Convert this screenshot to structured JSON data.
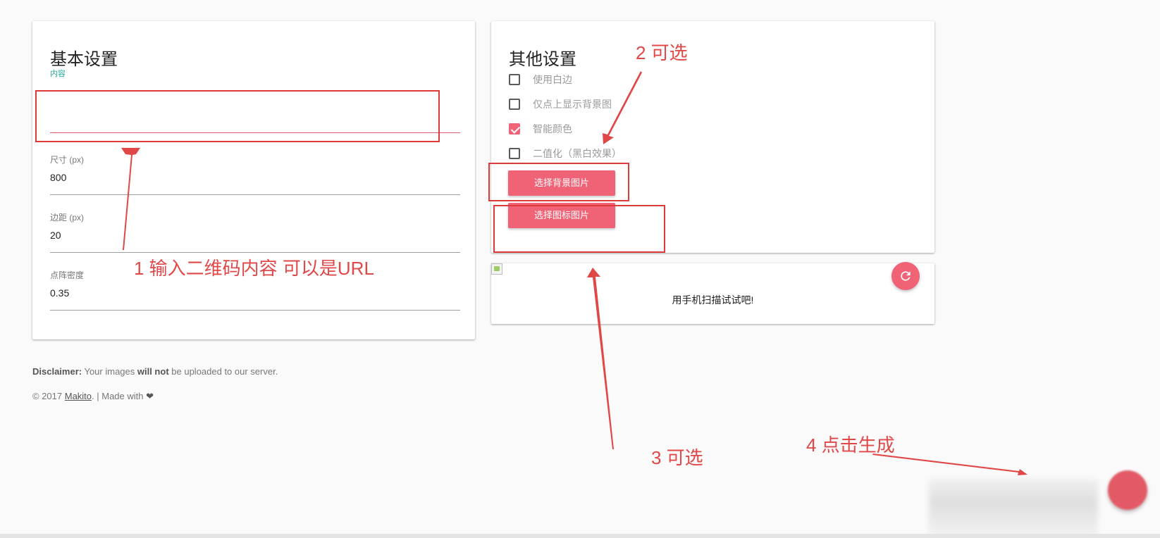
{
  "basic": {
    "title": "基本设置",
    "content_label": "内容",
    "content_value": "",
    "size_label": "尺寸 (px)",
    "size_value": "800",
    "margin_label": "边距 (px)",
    "margin_value": "20",
    "density_label": "点阵密度",
    "density_value": "0.35"
  },
  "other": {
    "title": "其他设置",
    "options": [
      {
        "label": "使用白边",
        "checked": false
      },
      {
        "label": "仅点上显示背景图",
        "checked": false
      },
      {
        "label": "智能颜色",
        "checked": true
      },
      {
        "label": "二值化（黑白效果）",
        "checked": false
      }
    ],
    "bg_button": "选择背景图片",
    "icon_button": "选择图标图片"
  },
  "preview": {
    "scan_text": "用手机扫描试试吧!"
  },
  "footer": {
    "disclaimer_bold": "Disclaimer:",
    "disclaimer_text1": " Your images ",
    "disclaimer_bold2": "will not",
    "disclaimer_text2": " be uploaded to our server.",
    "copyright": "© 2017 ",
    "author": "Makito",
    "made_with": ". | Made with "
  },
  "annotations": {
    "a1": "1 输入二维码内容 可以是URL",
    "a2": "2 可选",
    "a3": "3 可选",
    "a4": "4 点击生成"
  },
  "colors": {
    "accent": "#f06276",
    "annotation": "#e04848",
    "teal": "#26a69a"
  }
}
